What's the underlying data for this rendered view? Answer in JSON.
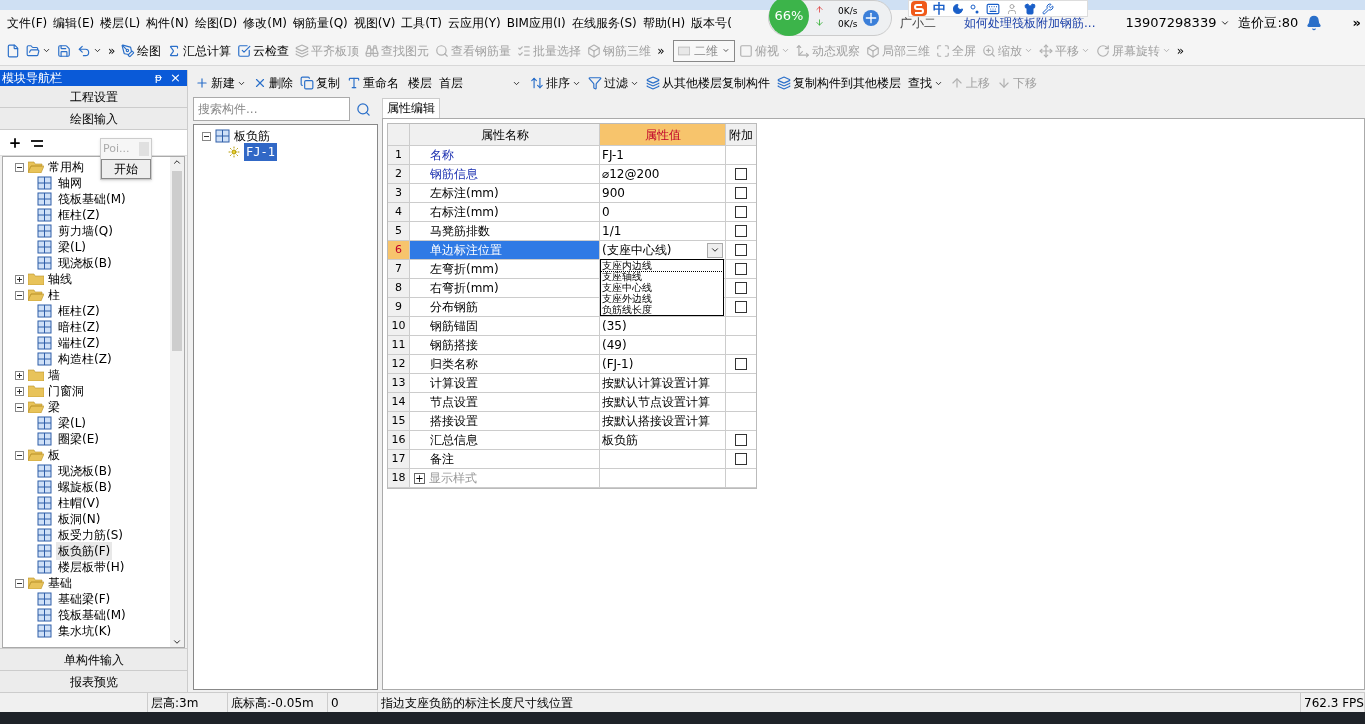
{
  "menu": [
    "文件(F)",
    "编辑(E)",
    "楼层(L)",
    "构件(N)",
    "绘图(D)",
    "修改(M)",
    "钢筋量(Q)",
    "视图(V)",
    "工具(T)",
    "云应用(Y)",
    "BIM应用(I)",
    "在线服务(S)",
    "帮助(H)",
    "版本号("
  ],
  "menu_right": {
    "assistant": "广小二",
    "link": "如何处理筏板附加钢筋...",
    "phone": "13907298339",
    "beans": "造价豆:80",
    "more": "»"
  },
  "net_widget": {
    "percent": "66%",
    "up": "0K/s",
    "down": "0K/s"
  },
  "ime_bar": {
    "mode": "中"
  },
  "toolbar": [
    {
      "disabled": false,
      "dropdown": false
    },
    {
      "disabled": false,
      "dropdown": true
    },
    {
      "disabled": false,
      "dropdown": false
    },
    {
      "disabled": false,
      "dropdown": true
    },
    {
      "label": "»",
      "disabled": false,
      "dropdown": false
    },
    {
      "label": "绘图",
      "disabled": false,
      "dropdown": false
    },
    {
      "label": "汇总计算",
      "disabled": false,
      "dropdown": false
    },
    {
      "label": "云检查",
      "disabled": false,
      "dropdown": false
    },
    {
      "label": "平齐板顶",
      "disabled": true,
      "dropdown": false
    },
    {
      "label": "查找图元",
      "disabled": true,
      "dropdown": false
    },
    {
      "label": "查看钢筋量",
      "disabled": true,
      "dropdown": false
    },
    {
      "label": "批量选择",
      "disabled": true,
      "dropdown": false
    },
    {
      "label": "钢筋三维",
      "disabled": true,
      "dropdown": false
    },
    {
      "label": "»",
      "disabled": false,
      "dropdown": false
    }
  ],
  "view_select": "二维",
  "view_tools": [
    {
      "label": "俯视",
      "disabled": true,
      "dropdown": true
    },
    {
      "label": "动态观察",
      "disabled": true,
      "dropdown": false
    },
    {
      "label": "局部三维",
      "disabled": true,
      "dropdown": false
    },
    {
      "label": "全屏",
      "disabled": true,
      "dropdown": false
    },
    {
      "label": "缩放",
      "disabled": true,
      "dropdown": true
    },
    {
      "label": "平移",
      "disabled": true,
      "dropdown": true
    },
    {
      "label": "屏幕旋转",
      "disabled": true,
      "dropdown": true
    },
    {
      "label": "»",
      "disabled": false,
      "dropdown": false
    }
  ],
  "nav": {
    "title": "模块导航栏",
    "pin": "ᵽ",
    "close": "×",
    "top_buttons": [
      "工程设置",
      "绘图输入"
    ],
    "bottom_buttons": [
      "单构件输入",
      "报表预览"
    ],
    "popup": {
      "title": "Poi...",
      "button": "开始"
    },
    "tree": [
      {
        "label": "常用构",
        "expanded": true,
        "children": [
          {
            "label": "轴网",
            "selected": false
          },
          {
            "label": "筏板基础(M)",
            "selected": false
          },
          {
            "label": "框柱(Z)",
            "selected": false
          },
          {
            "label": "剪力墙(Q)",
            "selected": false
          },
          {
            "label": "梁(L)",
            "selected": false
          },
          {
            "label": "现浇板(B)",
            "selected": false
          }
        ]
      },
      {
        "label": "轴线",
        "expanded": false
      },
      {
        "label": "柱",
        "expanded": true,
        "children": [
          {
            "label": "框柱(Z)",
            "selected": false
          },
          {
            "label": "暗柱(Z)",
            "selected": false
          },
          {
            "label": "端柱(Z)",
            "selected": false
          },
          {
            "label": "构造柱(Z)",
            "selected": false
          }
        ]
      },
      {
        "label": "墙",
        "expanded": false
      },
      {
        "label": "门窗洞",
        "expanded": false
      },
      {
        "label": "梁",
        "expanded": true,
        "children": [
          {
            "label": "梁(L)",
            "selected": false
          },
          {
            "label": "圈梁(E)",
            "selected": false
          }
        ]
      },
      {
        "label": "板",
        "expanded": true,
        "children": [
          {
            "label": "现浇板(B)",
            "selected": false
          },
          {
            "label": "螺旋板(B)",
            "selected": false
          },
          {
            "label": "柱帽(V)",
            "selected": false
          },
          {
            "label": "板洞(N)",
            "selected": false
          },
          {
            "label": "板受力筋(S)",
            "selected": false
          },
          {
            "label": "板负筋(F)",
            "selected": true
          },
          {
            "label": "楼层板带(H)",
            "selected": false
          }
        ]
      },
      {
        "label": "基础",
        "expanded": true,
        "children": [
          {
            "label": "基础梁(F)",
            "selected": false
          },
          {
            "label": "筏板基础(M)",
            "selected": false
          },
          {
            "label": "集水坑(K)",
            "selected": false
          }
        ]
      }
    ]
  },
  "component_toolbar": {
    "items": [
      {
        "label": "新建",
        "disabled": false,
        "dropdown": true
      },
      {
        "label": "删除",
        "disabled": false,
        "dropdown": false
      },
      {
        "label": "复制",
        "disabled": false,
        "dropdown": false
      },
      {
        "label": "重命名",
        "disabled": false,
        "dropdown": false
      }
    ],
    "floor_label": "楼层",
    "floor": "首层",
    "items2": [
      {
        "label": "排序",
        "disabled": false,
        "dropdown": true
      },
      {
        "label": "过滤",
        "disabled": false,
        "dropdown": true
      },
      {
        "label": "从其他楼层复制构件",
        "disabled": false,
        "dropdown": false
      },
      {
        "label": "复制构件到其他楼层",
        "disabled": false,
        "dropdown": false
      },
      {
        "label": "查找",
        "disabled": false,
        "dropdown": true
      },
      {
        "label": "上移",
        "disabled": true,
        "dropdown": false
      },
      {
        "label": "下移",
        "disabled": true,
        "dropdown": false
      }
    ]
  },
  "component_list": {
    "search_placeholder": "搜索构件...",
    "group": {
      "label": "板负筋",
      "expanded": true,
      "children": [
        {
          "label": "FJ-1",
          "selected": true
        }
      ]
    }
  },
  "property_editor": {
    "tab": "属性编辑",
    "columns": [
      "属性名称",
      "属性值",
      "附加"
    ],
    "rows": [
      {
        "num": "1",
        "name": "名称",
        "value": "FJ-1",
        "link": true,
        "selected": false
      },
      {
        "num": "2",
        "name": "钢筋信息",
        "value": "⌀12@200",
        "link": true,
        "selected": false,
        "checked": false
      },
      {
        "num": "3",
        "name": "左标注(mm)",
        "value": "900",
        "link": false,
        "selected": false,
        "checked": false
      },
      {
        "num": "4",
        "name": "右标注(mm)",
        "value": "0",
        "link": false,
        "selected": false,
        "checked": false
      },
      {
        "num": "5",
        "name": "马凳筋排数",
        "value": "1/1",
        "link": false,
        "selected": false,
        "checked": false
      },
      {
        "num": "6",
        "name": "单边标注位置",
        "value": "(支座中心线)",
        "selected": true,
        "checked": false
      },
      {
        "num": "7",
        "name": "左弯折(mm)",
        "link": false,
        "selected": false,
        "checked": false
      },
      {
        "num": "8",
        "name": "右弯折(mm)",
        "link": false,
        "selected": false,
        "checked": false
      },
      {
        "num": "9",
        "name": "分布钢筋",
        "link": false,
        "selected": false,
        "checked": false
      },
      {
        "num": "10",
        "name": "钢筋锚固",
        "value": "(35)",
        "link": false,
        "selected": false
      },
      {
        "num": "11",
        "name": "钢筋搭接",
        "value": "(49)",
        "link": false,
        "selected": false
      },
      {
        "num": "12",
        "name": "归类名称",
        "value": "(FJ-1)",
        "link": false,
        "selected": false,
        "checked": false
      },
      {
        "num": "13",
        "name": "计算设置",
        "value": "按默认计算设置计算",
        "link": false,
        "selected": false
      },
      {
        "num": "14",
        "name": "节点设置",
        "value": "按默认节点设置计算",
        "link": false,
        "selected": false
      },
      {
        "num": "15",
        "name": "搭接设置",
        "value": "按默认搭接设置计算",
        "link": false,
        "selected": false
      },
      {
        "num": "16",
        "name": "汇总信息",
        "value": "板负筋",
        "link": false,
        "selected": false,
        "checked": false
      },
      {
        "num": "17",
        "name": "备注",
        "link": false,
        "selected": false,
        "checked": false
      },
      {
        "num": "18",
        "name": "显示样式",
        "link": false,
        "selected": false,
        "expand": "+",
        "muted": true
      }
    ],
    "dropdown_options": [
      {
        "label": "支座内边线",
        "selected": true
      },
      {
        "label": "支座轴线",
        "selected": false
      },
      {
        "label": "支座中心线",
        "selected": false
      },
      {
        "label": "支座外边线",
        "selected": false
      },
      {
        "label": "负筋线长度",
        "selected": false
      }
    ]
  },
  "status_bar": [
    "层高:3m",
    "底标高:-0.05m",
    "0",
    "指边支座负筋的标注长度尺寸线位置",
    "762.3 FPS"
  ]
}
